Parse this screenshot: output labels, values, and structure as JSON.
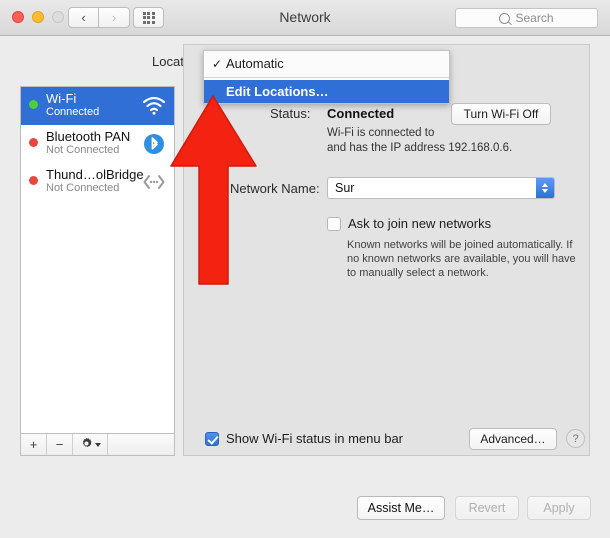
{
  "window": {
    "title": "Network",
    "traffic_lights": [
      "close",
      "minimize",
      "zoom"
    ],
    "nav": {
      "back": "‹",
      "forward": "›",
      "grid": "show-all-grid"
    },
    "search": {
      "placeholder": "Search",
      "value": ""
    }
  },
  "location_row": {
    "label": "Location:",
    "selected": "Automatic"
  },
  "location_menu": {
    "open": true,
    "items": [
      {
        "label": "Automatic",
        "checked": true,
        "selected": false,
        "check_glyph": "✓"
      },
      {
        "label": "Edit Locations…",
        "checked": false,
        "selected": true,
        "check_glyph": ""
      }
    ]
  },
  "sidebar": {
    "services": [
      {
        "name": "Wi-Fi",
        "status": "Connected",
        "dot": "green",
        "selected": true,
        "icon": "wifi-icon"
      },
      {
        "name": "Bluetooth PAN",
        "status": "Not Connected",
        "dot": "red",
        "selected": false,
        "icon": "bluetooth-icon"
      },
      {
        "name": "Thund…olBridge",
        "status": "Not Connected",
        "dot": "red",
        "selected": false,
        "icon": "thunderbolt-bridge-icon"
      }
    ],
    "footer": {
      "add": "+",
      "remove": "−",
      "gear": "gear-icon"
    }
  },
  "detail": {
    "status_label": "Status:",
    "status_value": "Connected",
    "toggle_button": "Turn Wi-Fi Off",
    "status_description": "Wi-Fi is connected to and has the IP address 192.168.0.6.",
    "status_description_line1": "Wi-Fi is connected to",
    "status_description_line2": "and has the IP address 192.168.0.6.",
    "ip_address": "192.168.0.6",
    "network_name_label": "Network Name:",
    "network_name_value": "Sur",
    "ask_join_label": "Ask to join new networks",
    "ask_join_checked": false,
    "ask_join_help": "Known networks will be joined automatically. If no known networks are available, you will have to manually select a network.",
    "show_status_label": "Show Wi-Fi status in menu bar",
    "show_status_checked": true,
    "advanced_button": "Advanced…",
    "help_button": "?"
  },
  "footer": {
    "assist": "Assist Me…",
    "revert": "Revert",
    "apply": "Apply"
  },
  "annotation": {
    "type": "arrow",
    "direction": "up",
    "color": "#f42211",
    "points_at": "Edit Locations…"
  },
  "colors": {
    "accent_blue": "#2f6fd6",
    "selection_blue": "#2f6fd6",
    "connected_green": "#4cd137",
    "disconnected_red": "#e8453c",
    "annotation_red": "#f42211",
    "window_background": "#ececec",
    "panel_background": "#e3e3e3"
  }
}
